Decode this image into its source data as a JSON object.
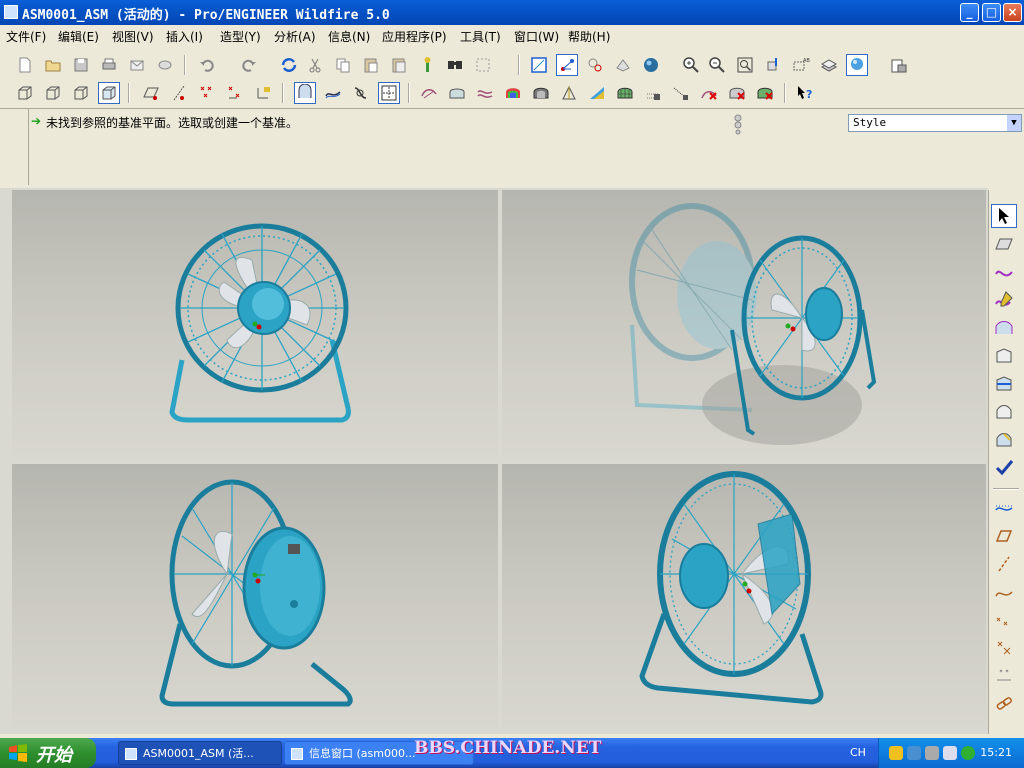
{
  "window": {
    "title": "ASM0001_ASM (活动的) - Pro/ENGINEER Wildfire 5.0",
    "btn_minimize": "_",
    "btn_maximize": "□",
    "btn_close": "×"
  },
  "menu": [
    "文件(F)",
    "编辑(E)",
    "视图(V)",
    "插入(I)",
    "造型(Y)",
    "分析(A)",
    "信息(N)",
    "应用程序(P)",
    "工具(T)",
    "窗口(W)",
    "帮助(H)"
  ],
  "message": {
    "text": "未找到参照的基准平面。选取或创建一个基准。"
  },
  "style_select": {
    "value": "Style"
  },
  "taskbar": {
    "start_label": "开始",
    "items": [
      "ASM0001_ASM (活...",
      "信息窗口 (asm000..."
    ],
    "watermark": "BBS.CHINADE.NET",
    "language": "CH",
    "clock": "15:21"
  },
  "colors": {
    "fan_teal": "#2aa3c4",
    "fan_dark": "#1a7d9c",
    "titlebar": "#0553c7",
    "start_green": "#2e8f2e"
  },
  "icons": {
    "toolbar_row1": [
      "new-icon",
      "open-icon",
      "save-icon",
      "print-icon",
      "email-icon",
      "undo-icon",
      "redo-icon",
      "regenerate-icon",
      "cut-icon",
      "copy-icon",
      "paste-icon",
      "paste-special-icon",
      "model-tree-icon",
      "find-icon",
      "select-box-icon",
      "datum-display-icon",
      "spin-center-icon",
      "axis-display-icon",
      "point-display-icon",
      "shading-icon",
      "zoom-in-icon",
      "zoom-out-icon",
      "refit-icon",
      "reorient-icon",
      "saved-views-icon",
      "layers-icon",
      "appearance-icon",
      "view-manager-icon"
    ],
    "toolbar_row2": [
      "hidden-line-icon",
      "no-hidden-icon",
      "wireframe-icon",
      "shaded-icon",
      "sketch-plane-icon",
      "curve-icon",
      "point-icon",
      "datum-point-icon",
      "datum-coord-icon",
      "style-icon",
      "surface-icon",
      "curvature-icon",
      "section-icon",
      "reflection-icon",
      "shading-analysis-icon",
      "draft-icon",
      "slope-icon",
      "mesh-icon",
      "dihedral-icon",
      "offset-icon",
      "deviation-icon",
      "help-icon"
    ],
    "right_toolbar": [
      "select-arrow-icon",
      "surface-style-icon",
      "curve-style-icon",
      "draw-curve-icon",
      "surface-boundary-icon",
      "surface-merge-icon",
      "surface-trim-icon",
      "surface-connect-icon",
      "curve-edit-icon",
      "accept-check-icon",
      "datum-curve-icon",
      "datum-plane-icon",
      "datum-axis-icon",
      "sketch-curve-icon",
      "datum-point-icon",
      "datum-csys-icon",
      "analysis-icon",
      "chain-icon"
    ]
  }
}
